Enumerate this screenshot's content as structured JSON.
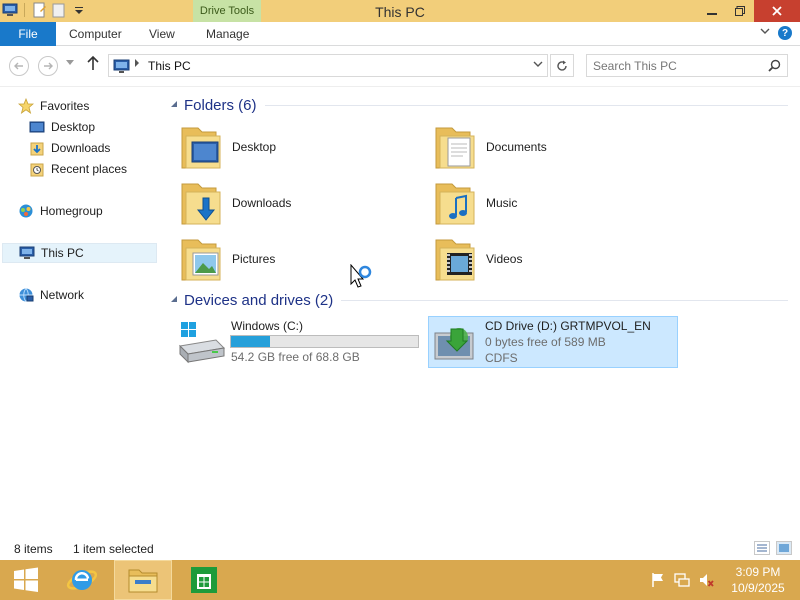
{
  "window": {
    "title": "This PC",
    "contextual_tab": "Drive Tools",
    "close_color": "#c7402f",
    "titlebar_color": "#f2ce7a"
  },
  "ribbon": {
    "tabs": [
      "File",
      "Computer",
      "View",
      "Manage"
    ],
    "file_color": "#1979ca",
    "help_label": "?"
  },
  "address": {
    "path": "This PC",
    "search_placeholder": "Search This PC"
  },
  "nav": {
    "favorites": "Favorites",
    "favorite_items": [
      "Desktop",
      "Downloads",
      "Recent places"
    ],
    "homegroup": "Homegroup",
    "this_pc": "This PC",
    "network": "Network"
  },
  "groups": {
    "folders": "Folders (6)",
    "drives": "Devices and drives (2)"
  },
  "folders": [
    {
      "label": "Desktop",
      "icon": "desktop-folder-icon"
    },
    {
      "label": "Documents",
      "icon": "documents-folder-icon"
    },
    {
      "label": "Downloads",
      "icon": "downloads-folder-icon"
    },
    {
      "label": "Music",
      "icon": "music-folder-icon"
    },
    {
      "label": "Pictures",
      "icon": "pictures-folder-icon"
    },
    {
      "label": "Videos",
      "icon": "videos-folder-icon"
    }
  ],
  "drives": [
    {
      "name": "Windows (C:)",
      "free_text": "54.2 GB free of 68.8 GB",
      "used_fraction": 0.21,
      "icon": "hard-drive-icon"
    },
    {
      "name": "CD Drive (D:) GRTMPVOL_EN",
      "free_text": "0 bytes free of 589 MB",
      "fs": "CDFS",
      "icon": "cd-drive-icon"
    }
  ],
  "status": {
    "items": "8 items",
    "selected": "1 item selected"
  },
  "taskbar": {
    "time": "3:09 PM",
    "date": "10/9/2025",
    "color": "#d9a84f"
  }
}
